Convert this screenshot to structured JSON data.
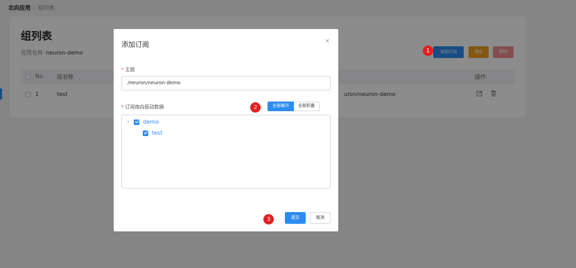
{
  "breadcrumb": {
    "first": "北向应用",
    "separator": "/",
    "current": "组列表"
  },
  "page": {
    "title": "组列表",
    "app_name_label": "应用名称",
    "app_name_value": "neuron-demo",
    "actions": {
      "add": "添加订阅",
      "clear": "清空",
      "delete": "删除"
    },
    "table": {
      "headers": {
        "no": "No",
        "group": "组名称",
        "ops": "操作"
      },
      "rows": [
        {
          "no": "1",
          "group": "test",
          "topic_fragment": "uron/neuron-demo"
        }
      ]
    }
  },
  "modal": {
    "title": "添加订阅",
    "close": "×",
    "topic_label": "主题",
    "topic_value": "/neuron/neuron-demo",
    "data_label": "订阅南向驱动数据",
    "expand_all": "全部展开",
    "collapse_all": "全部折叠",
    "tree": {
      "parent": "demo",
      "child": "test"
    },
    "submit": "提交",
    "cancel": "取消"
  },
  "steps": [
    "1",
    "2",
    "3"
  ],
  "colors": {
    "primary": "#2d8cf0",
    "warning": "#f0a020",
    "danger": "#f28f8f",
    "badge": "#e02020"
  }
}
